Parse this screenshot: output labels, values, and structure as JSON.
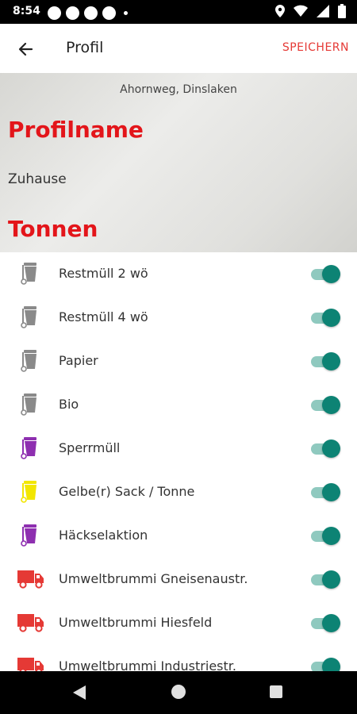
{
  "status_bar": {
    "time": "8:54"
  },
  "app_bar": {
    "title": "Profil",
    "save_label": "SPEICHERN"
  },
  "header": {
    "address": "Ahornweg, Dinslaken",
    "profile_heading": "Profilname",
    "profile_value": "Zuhause",
    "bins_heading": "Tonnen"
  },
  "bins": [
    {
      "label": "Restmüll 2 wö",
      "icon": "trash-bin-icon",
      "color": "#8a8a8a",
      "enabled": true
    },
    {
      "label": "Restmüll 4 wö",
      "icon": "trash-bin-icon",
      "color": "#8a8a8a",
      "enabled": true
    },
    {
      "label": "Papier",
      "icon": "trash-bin-icon",
      "color": "#8a8a8a",
      "enabled": true
    },
    {
      "label": "Bio",
      "icon": "trash-bin-icon",
      "color": "#8a8a8a",
      "enabled": true
    },
    {
      "label": "Sperrmüll",
      "icon": "trash-bin-icon",
      "color": "#8e2fb0",
      "enabled": true
    },
    {
      "label": "Gelbe(r) Sack / Tonne",
      "icon": "trash-bin-icon",
      "color": "#f2e600",
      "enabled": true
    },
    {
      "label": "Häckselaktion",
      "icon": "trash-bin-icon",
      "color": "#8e2fb0",
      "enabled": true
    },
    {
      "label": "Umweltbrummi Gneisenaustr.",
      "icon": "truck-icon",
      "color": "#e53935",
      "enabled": true
    },
    {
      "label": "Umweltbrummi Hiesfeld",
      "icon": "truck-icon",
      "color": "#e53935",
      "enabled": true
    },
    {
      "label": "Umweltbrummi Industriestr.",
      "icon": "truck-icon",
      "color": "#e53935",
      "enabled": true
    }
  ],
  "colors": {
    "accent": "#e3151a",
    "toggle_on": "#0d8374"
  }
}
